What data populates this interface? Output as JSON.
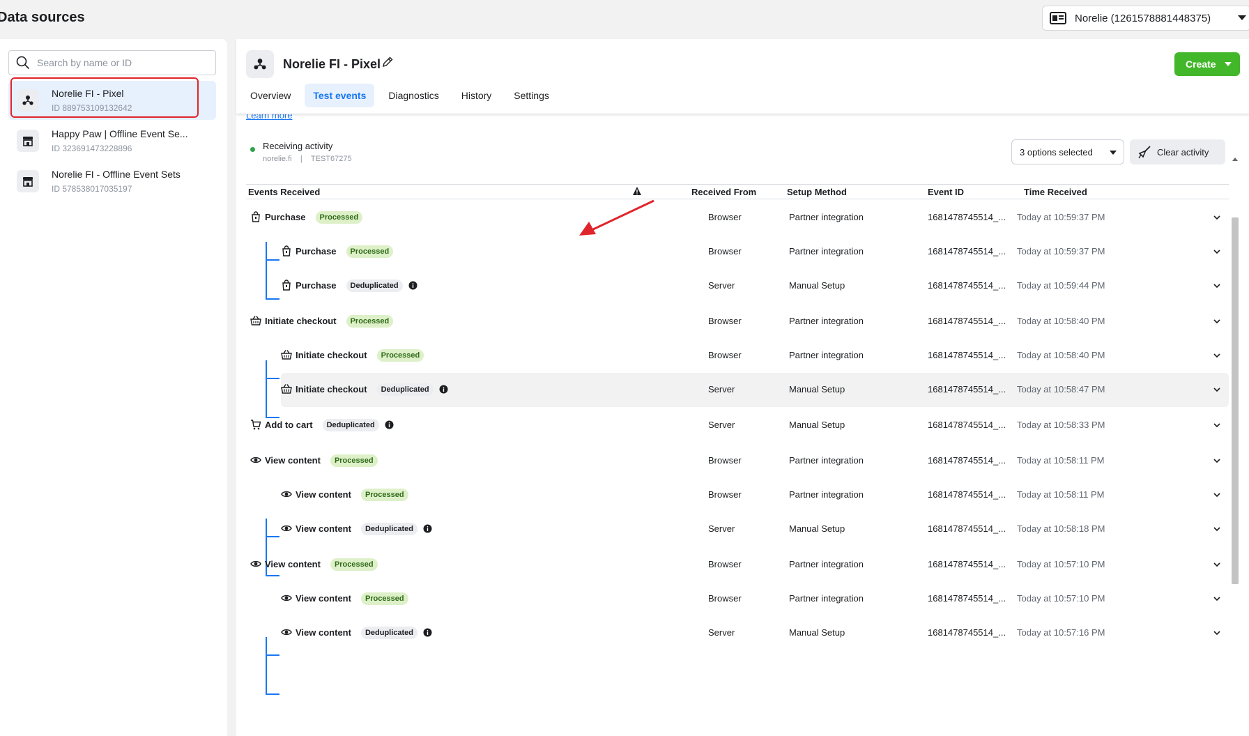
{
  "page": {
    "title": "Data sources"
  },
  "account": {
    "label": "Norelie (1261578881448375)"
  },
  "sidebar": {
    "search_placeholder": "Search by name or ID",
    "items": [
      {
        "name": "Norelie FI - Pixel",
        "id": "ID 889753109132642",
        "icon": "pixel-icon",
        "selected": true
      },
      {
        "name": "Happy Paw | Offline Event Se...",
        "id": "ID 323691473228896",
        "icon": "store-icon",
        "selected": false
      },
      {
        "name": "Norelie FI - Offline Event Sets",
        "id": "ID 578538017035197",
        "icon": "store-icon",
        "selected": false
      }
    ]
  },
  "header": {
    "title": "Norelie FI - Pixel",
    "create_label": "Create",
    "tabs": [
      {
        "label": "Overview",
        "active": false
      },
      {
        "label": "Test events",
        "active": true
      },
      {
        "label": "Diagnostics",
        "active": false
      },
      {
        "label": "History",
        "active": false
      },
      {
        "label": "Settings",
        "active": false
      }
    ]
  },
  "learn_more": "Learn more",
  "activity": {
    "status": "Receiving activity",
    "domain": "norelie.fi",
    "separator": "|",
    "test_code": "TEST67275",
    "options_label": "3 options selected",
    "clear_label": "Clear activity"
  },
  "table": {
    "headers": {
      "events": "Events Received",
      "received_from": "Received From",
      "setup_method": "Setup Method",
      "event_id": "Event ID",
      "time": "Time Received"
    },
    "rows": [
      {
        "level": 0,
        "icon": "shopping-bag-icon",
        "name": "Purchase",
        "status": "Processed",
        "from": "Browser",
        "method": "Partner integration",
        "event_id": "1681478745514_...",
        "time": "Today at 10:59:37 PM"
      },
      {
        "level": 1,
        "icon": "shopping-bag-icon",
        "name": "Purchase",
        "status": "Processed",
        "from": "Browser",
        "method": "Partner integration",
        "event_id": "1681478745514_...",
        "time": "Today at 10:59:37 PM"
      },
      {
        "level": 1,
        "icon": "shopping-bag-icon",
        "name": "Purchase",
        "status": "Deduplicated",
        "from": "Server",
        "method": "Manual Setup",
        "event_id": "1681478745514_...",
        "time": "Today at 10:59:44 PM"
      },
      {
        "level": 0,
        "icon": "basket-icon",
        "name": "Initiate checkout",
        "status": "Processed",
        "from": "Browser",
        "method": "Partner integration",
        "event_id": "1681478745514_...",
        "time": "Today at 10:58:40 PM"
      },
      {
        "level": 1,
        "icon": "basket-icon",
        "name": "Initiate checkout",
        "status": "Processed",
        "from": "Browser",
        "method": "Partner integration",
        "event_id": "1681478745514_...",
        "time": "Today at 10:58:40 PM"
      },
      {
        "level": 1,
        "icon": "basket-icon",
        "name": "Initiate checkout",
        "status": "Deduplicated",
        "from": "Server",
        "method": "Manual Setup",
        "event_id": "1681478745514_...",
        "time": "Today at 10:58:47 PM",
        "highlighted": true
      },
      {
        "level": 0,
        "icon": "cart-icon",
        "name": "Add to cart",
        "status": "Deduplicated",
        "from": "Server",
        "method": "Manual Setup",
        "event_id": "1681478745514_...",
        "time": "Today at 10:58:33 PM"
      },
      {
        "level": 0,
        "icon": "eye-icon",
        "name": "View content",
        "status": "Processed",
        "from": "Browser",
        "method": "Partner integration",
        "event_id": "1681478745514_...",
        "time": "Today at 10:58:11 PM"
      },
      {
        "level": 1,
        "icon": "eye-icon",
        "name": "View content",
        "status": "Processed",
        "from": "Browser",
        "method": "Partner integration",
        "event_id": "1681478745514_...",
        "time": "Today at 10:58:11 PM"
      },
      {
        "level": 1,
        "icon": "eye-icon",
        "name": "View content",
        "status": "Deduplicated",
        "from": "Server",
        "method": "Manual Setup",
        "event_id": "1681478745514_...",
        "time": "Today at 10:58:18 PM"
      },
      {
        "level": 0,
        "icon": "eye-icon",
        "name": "View content",
        "status": "Processed",
        "from": "Browser",
        "method": "Partner integration",
        "event_id": "1681478745514_...",
        "time": "Today at 10:57:10 PM"
      },
      {
        "level": 1,
        "icon": "eye-icon",
        "name": "View content",
        "status": "Processed",
        "from": "Browser",
        "method": "Partner integration",
        "event_id": "1681478745514_...",
        "time": "Today at 10:57:10 PM"
      },
      {
        "level": 1,
        "icon": "eye-icon",
        "name": "View content",
        "status": "Deduplicated",
        "from": "Server",
        "method": "Manual Setup",
        "event_id": "1681478745514_...",
        "time": "Today at 10:57:16 PM"
      }
    ]
  },
  "colors": {
    "accent": "#1877f2",
    "create_green": "#42b72a",
    "highlight_red": "#e0242b",
    "status_dot": "#31a24c"
  }
}
